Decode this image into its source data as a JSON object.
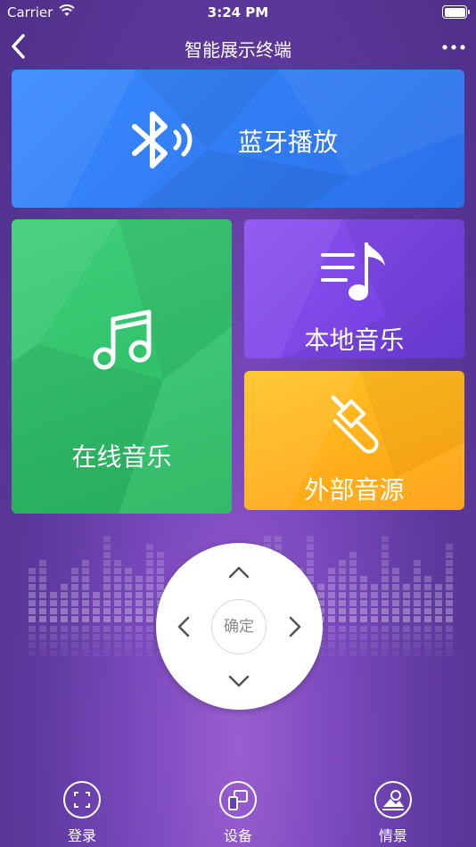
{
  "status_bar": {
    "carrier": "Carrier",
    "time": "3:24 PM"
  },
  "navbar": {
    "title": "智能展示终端"
  },
  "tiles": {
    "bluetooth": {
      "label": "蓝牙播放",
      "icon": "bluetooth-icon"
    },
    "online_music": {
      "label": "在线音乐",
      "icon": "music-note-icon"
    },
    "local_music": {
      "label": "本地音乐",
      "icon": "playlist-icon"
    },
    "external_source": {
      "label": "外部音源",
      "icon": "audio-jack-icon"
    }
  },
  "dpad": {
    "ok_label": "确定"
  },
  "tabbar": {
    "items": [
      {
        "label": "登录",
        "icon": "scan-icon"
      },
      {
        "label": "设备",
        "icon": "devices-icon"
      },
      {
        "label": "情景",
        "icon": "scene-icon"
      }
    ]
  },
  "colors": {
    "bluetooth_tile": "#3a8bff",
    "online_tile": "#3fcf7a",
    "local_tile": "#8e52f2",
    "external_tile": "#ffb01c",
    "background": "#6a40ad"
  }
}
